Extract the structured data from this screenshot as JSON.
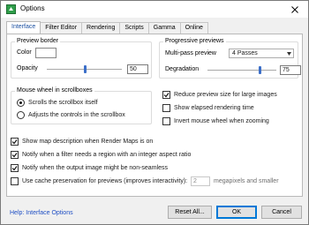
{
  "window": {
    "title": "Options",
    "close_icon": "close-icon",
    "app_icon": "options-icon"
  },
  "tabs": [
    {
      "label": "Interface",
      "active": true
    },
    {
      "label": "Filter Editor"
    },
    {
      "label": "Rendering"
    },
    {
      "label": "Scripts"
    },
    {
      "label": "Gamma"
    },
    {
      "label": "Online"
    }
  ],
  "preview_border": {
    "title": "Preview border",
    "color_label": "Color",
    "opacity_label": "Opacity",
    "opacity_value": "50",
    "opacity_fraction": 0.5
  },
  "progressive_previews": {
    "title": "Progressive previews",
    "multipass_label": "Multi-pass preview",
    "multipass_value": "4 Passes",
    "degradation_label": "Degradation",
    "degradation_value": "75",
    "degradation_fraction": 0.75
  },
  "mouse_wheel": {
    "title": "Mouse wheel in scrollboxes",
    "options": [
      {
        "label": "Scrolls the scrollbox itself",
        "selected": true
      },
      {
        "label": "Adjusts the controls in the scrollbox",
        "selected": false
      }
    ]
  },
  "right_checks": [
    {
      "label": "Reduce preview size for large images",
      "checked": true
    },
    {
      "label": "Show elapsed rendering time",
      "checked": false
    },
    {
      "label": "Invert mouse wheel when zooming",
      "checked": false
    }
  ],
  "bottom_checks": [
    {
      "label": "Show map description when Render Maps is on",
      "checked": true
    },
    {
      "label": "Notify when a filter needs a region with an integer aspect ratio",
      "checked": true
    },
    {
      "label": "Notify when the output image might be non-seamless",
      "checked": true
    },
    {
      "label": "Use cache preservation for previews (improves interactivity):",
      "checked": false
    }
  ],
  "cache": {
    "value": "2",
    "suffix": "megapixels and smaller"
  },
  "footer": {
    "help_link": "Help: Interface Options",
    "reset_label": "Reset All...",
    "ok_label": "OK",
    "cancel_label": "Cancel"
  }
}
